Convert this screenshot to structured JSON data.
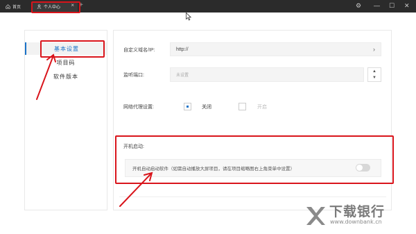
{
  "titlebar": {
    "tab_home": "首页",
    "tab_active": "个人中心",
    "tab_close": "×",
    "tab_add": "+",
    "win_settings": "⚙",
    "win_min": "—",
    "win_max": "☐",
    "win_close": "✕"
  },
  "sidebar": {
    "items": [
      {
        "label": "基本设置"
      },
      {
        "label": "项目码"
      },
      {
        "label": "软件版本"
      }
    ]
  },
  "settings": {
    "domain_label": "自定义域名/IP:",
    "domain_value": "http://",
    "port_label": "监听端口:",
    "port_placeholder": "未设置",
    "proxy_label": "网络代理设置:",
    "proxy_off": "关闭",
    "proxy_on": "开启",
    "autostart_label": "开机启动:",
    "autostart_text": "开机自动启动软件（如需自动播放大屏项目，请在项目缩略图右上角菜单中设置）",
    "autostart_enabled": false
  },
  "watermark": {
    "cn": "下载银行",
    "en": "www.downbank.cn"
  },
  "colors": {
    "accent": "#1a73c8",
    "annotation": "#d9141b"
  }
}
